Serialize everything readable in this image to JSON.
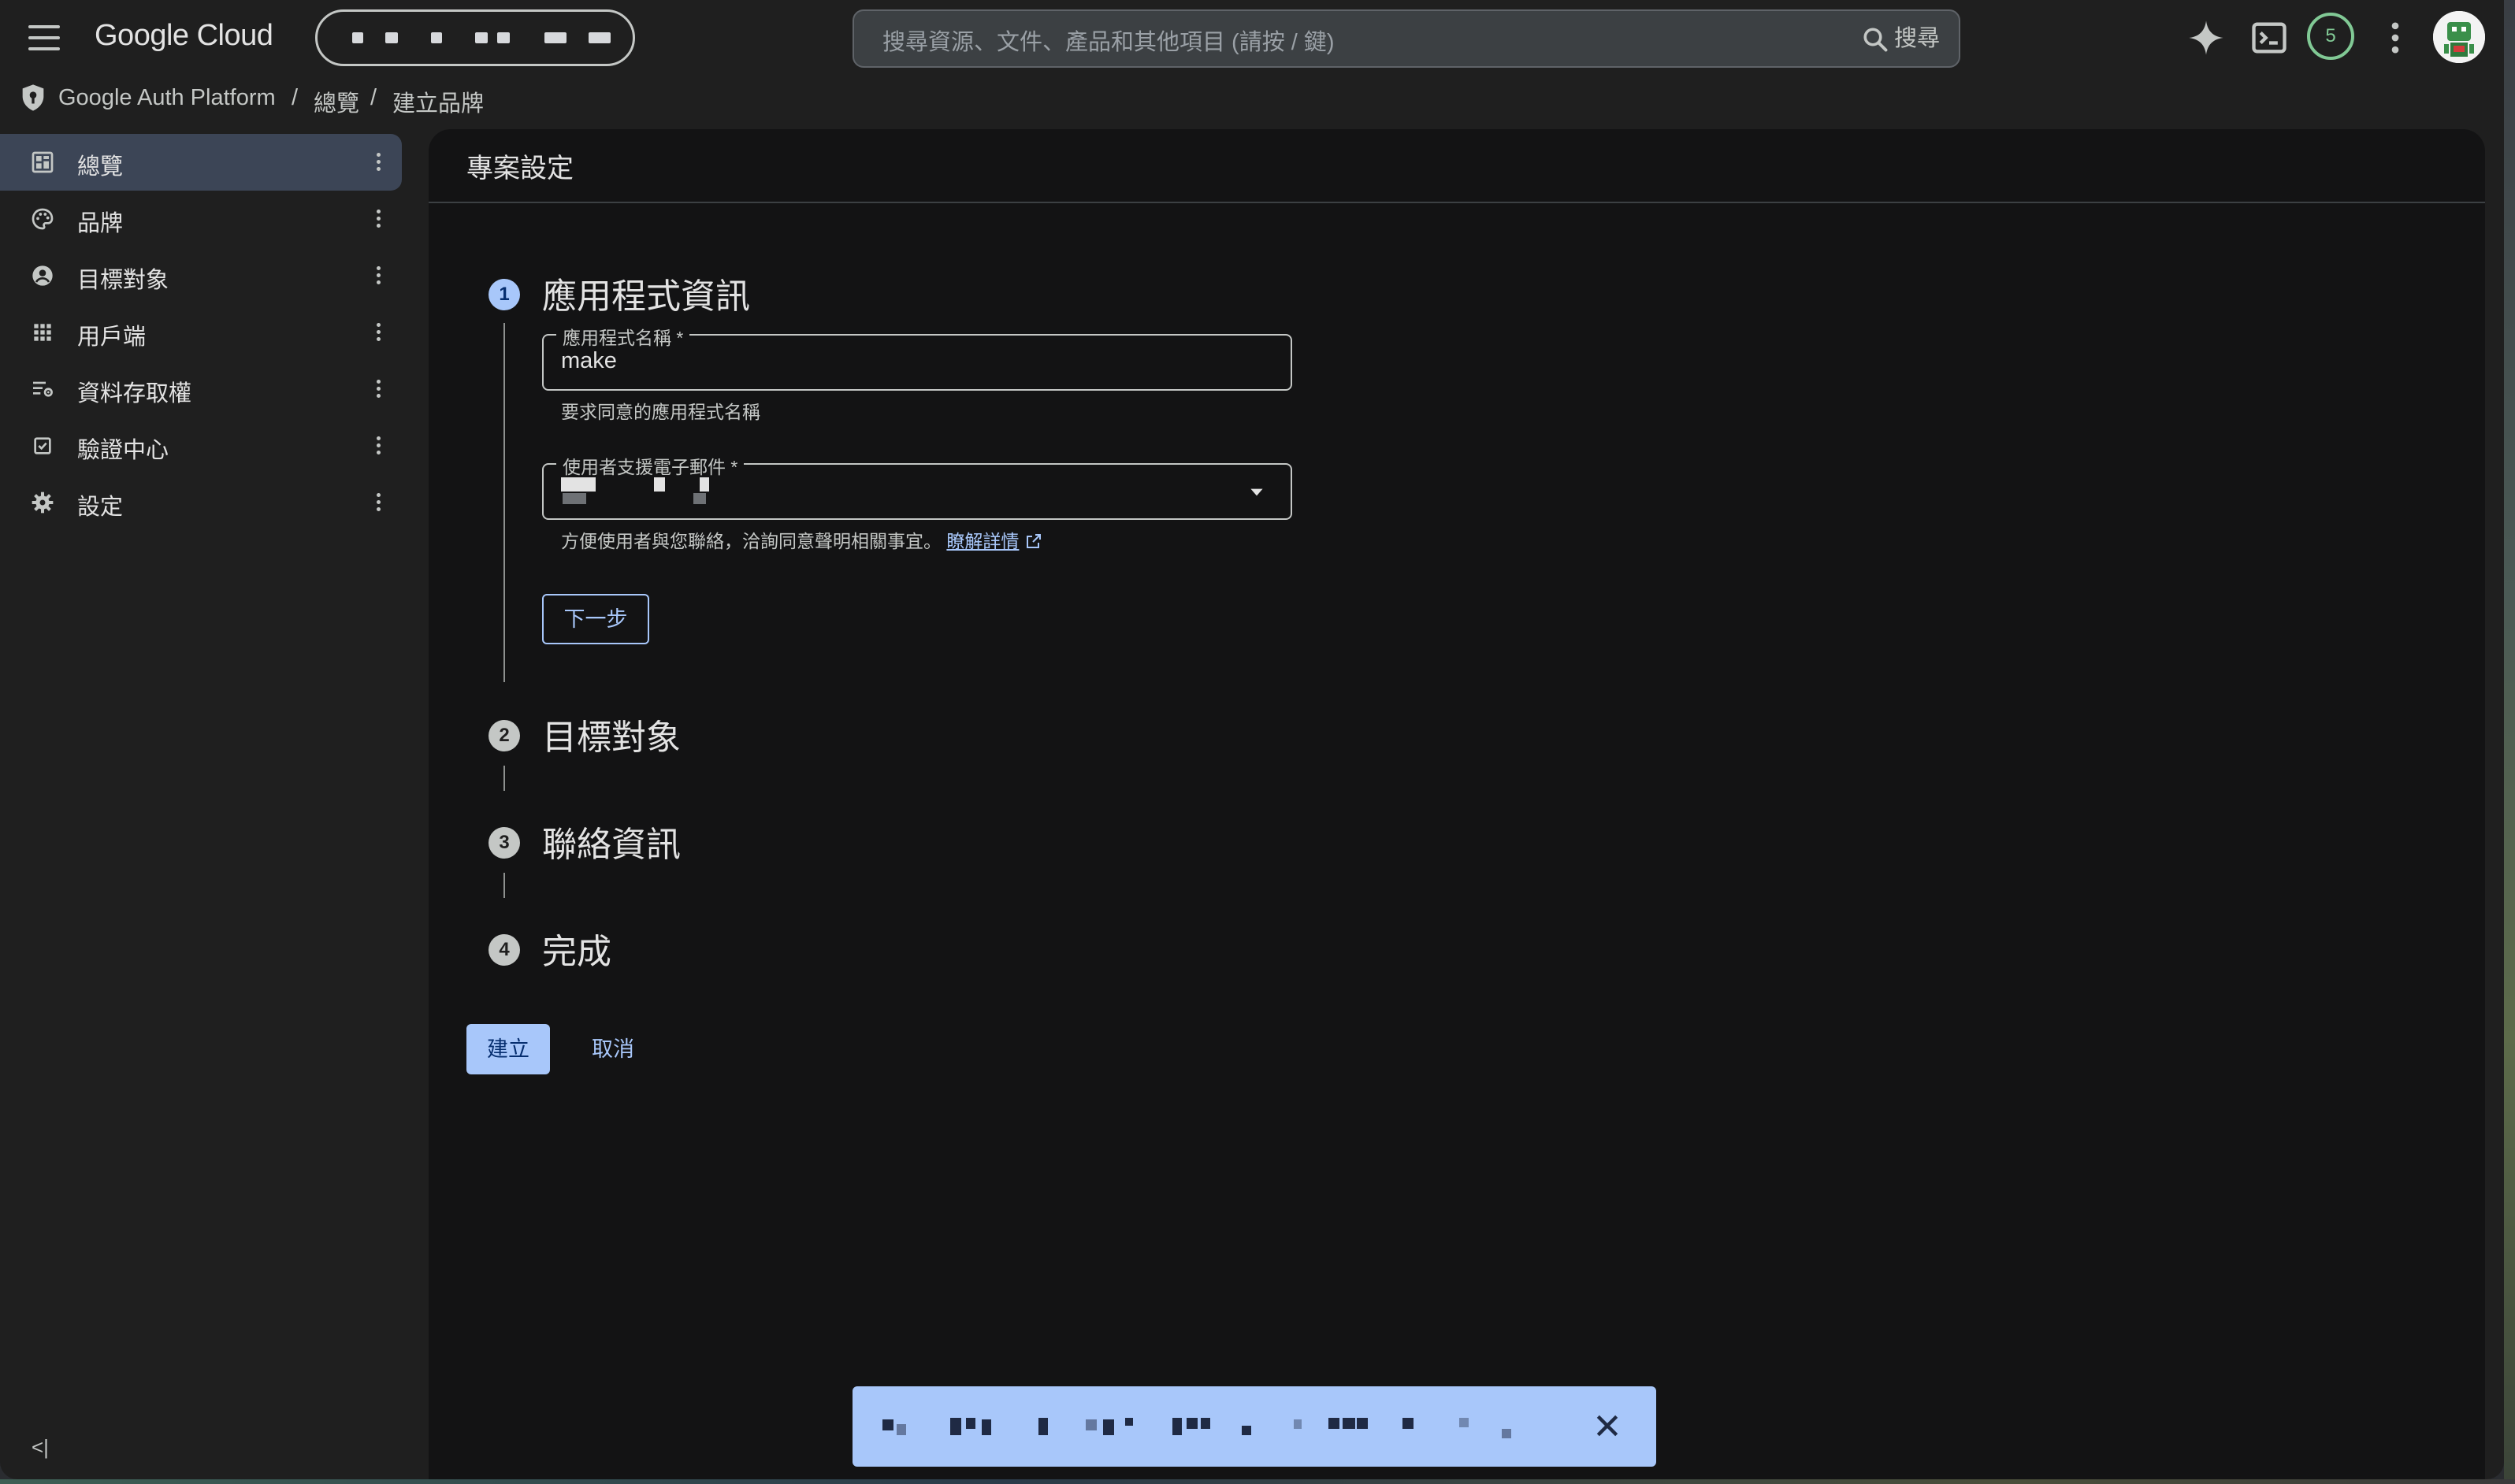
{
  "topbar": {
    "logo": "Google Cloud",
    "search_placeholder": "搜尋資源、文件、產品和其他項目 (請按 / 鍵)",
    "search_button": "搜尋",
    "notification_count": "5"
  },
  "breadcrumb": {
    "product": "Google Auth Platform",
    "separator": "/",
    "overview": "總覽",
    "current": "建立品牌"
  },
  "sidebar": {
    "items": [
      {
        "label": "總覽",
        "icon": "dashboard-icon",
        "active": true
      },
      {
        "label": "品牌",
        "icon": "palette-icon",
        "active": false
      },
      {
        "label": "目標對象",
        "icon": "account-circle-icon",
        "active": false
      },
      {
        "label": "用戶端",
        "icon": "apps-grid-icon",
        "active": false
      },
      {
        "label": "資料存取權",
        "icon": "data-access-icon",
        "active": false
      },
      {
        "label": "驗證中心",
        "icon": "checkbox-icon",
        "active": false
      },
      {
        "label": "設定",
        "icon": "gear-icon",
        "active": false
      }
    ],
    "collapse_label": "<|"
  },
  "page": {
    "title": "專案設定",
    "steps": [
      {
        "number": "1",
        "title": "應用程式資訊",
        "state": "active"
      },
      {
        "number": "2",
        "title": "目標對象",
        "state": "pending"
      },
      {
        "number": "3",
        "title": "聯絡資訊",
        "state": "pending"
      },
      {
        "number": "4",
        "title": "完成",
        "state": "pending"
      }
    ],
    "app_name_field": {
      "label": "應用程式名稱 *",
      "value": "make",
      "helper": "要求同意的應用程式名稱"
    },
    "support_email_field": {
      "label": "使用者支援電子郵件 *",
      "value_redacted": true,
      "helper": "方便使用者與您聯絡，洽詢同意聲明相關事宜。",
      "learn_more": "瞭解詳情"
    },
    "next_button": "下一步",
    "create_button": "建立",
    "cancel_button": "取消"
  },
  "toast": {
    "message_redacted": true
  },
  "colors": {
    "background": "#1f1f1f",
    "panel": "#131314",
    "accent": "#a8c7fa",
    "active_nav": "#3c4556",
    "badge": "#81c995"
  }
}
